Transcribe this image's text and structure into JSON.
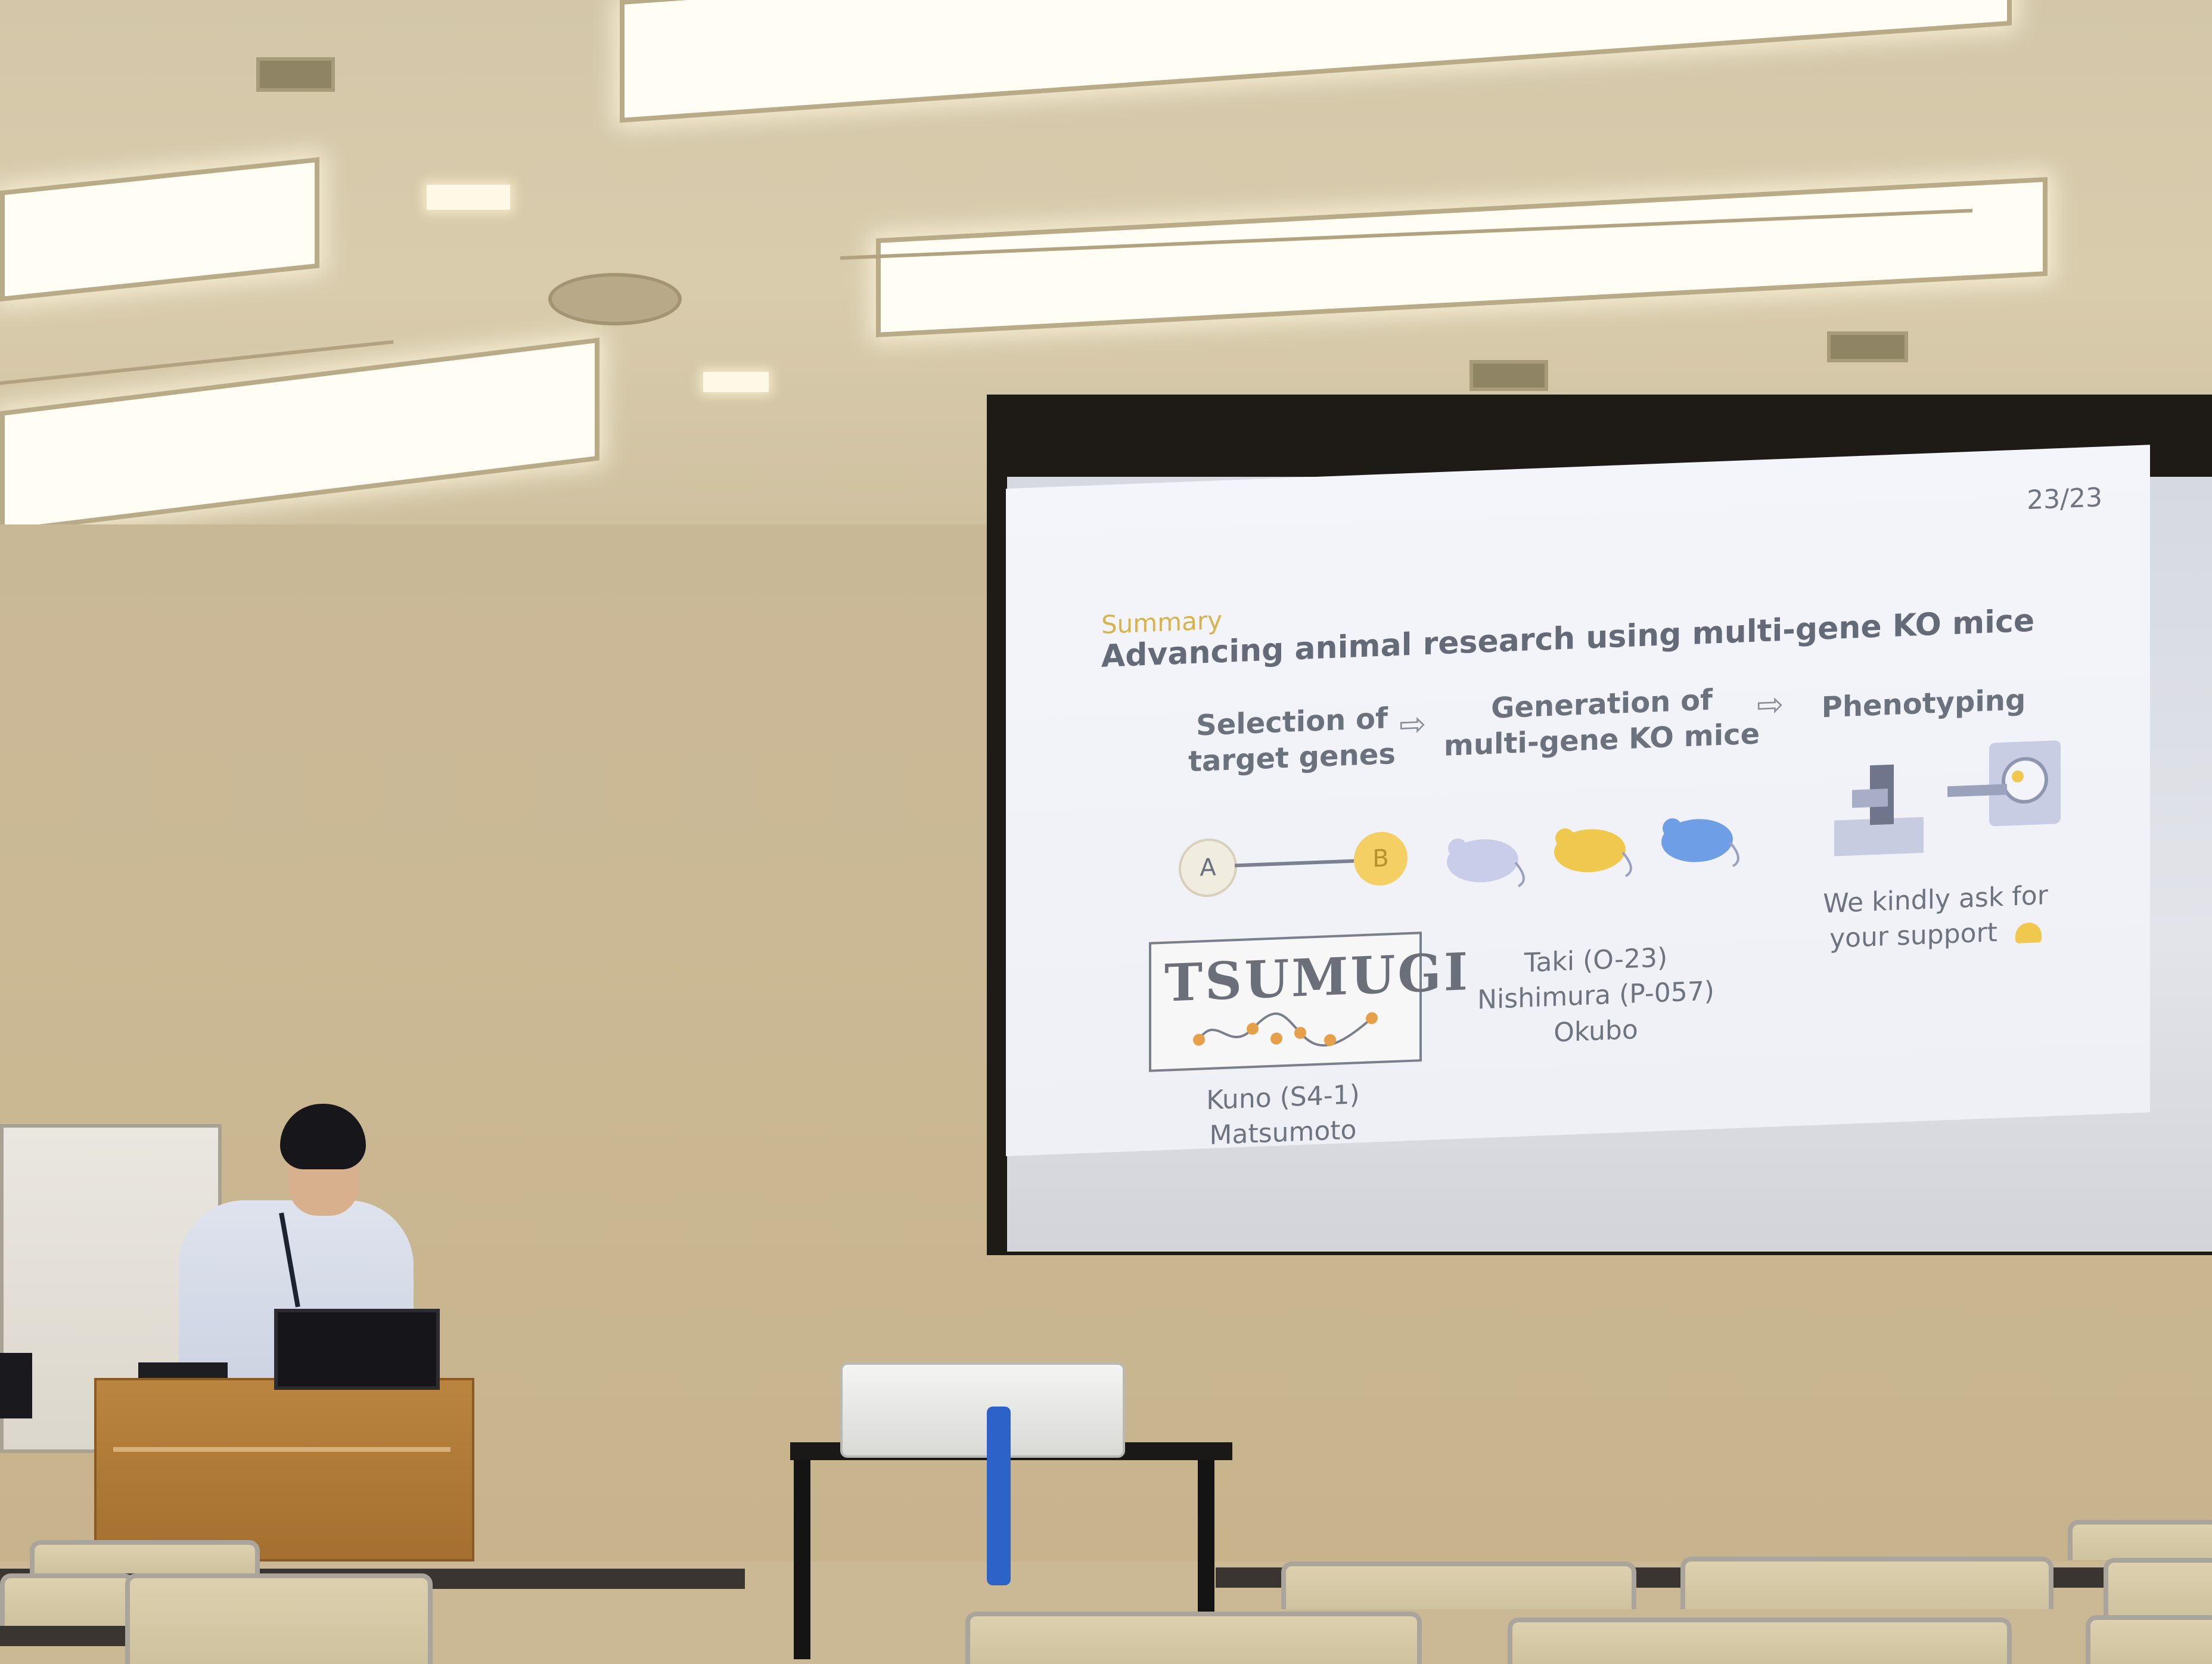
{
  "slide": {
    "page_number": "23/23",
    "section": "Summary",
    "title": "Advancing animal research using multi-gene KO mice",
    "columns": [
      {
        "heading_line1": "Selection of",
        "heading_line2": "target genes",
        "node_a": "A",
        "node_b": "B",
        "logo_text": "TSUMUGI",
        "credits": [
          "Kuno (S4-1)",
          "Matsumoto"
        ]
      },
      {
        "heading_line1": "Generation of",
        "heading_line2": "multi-gene KO mice",
        "credits": [
          "Taki (O-23)",
          "Nishimura (P-057)",
          "Okubo"
        ]
      },
      {
        "heading_line1": "Phenotyping",
        "support_line1": "We kindly ask for",
        "support_line2": "your support"
      }
    ],
    "arrow_symbol": "⇨",
    "colors": {
      "accent_yellow": "#d8b24a",
      "node_b_fill": "#f4cf64",
      "mouse_colors": [
        "#c9cdea",
        "#f0c84e",
        "#6e9fe6"
      ],
      "text_gray": "#656a78"
    }
  }
}
